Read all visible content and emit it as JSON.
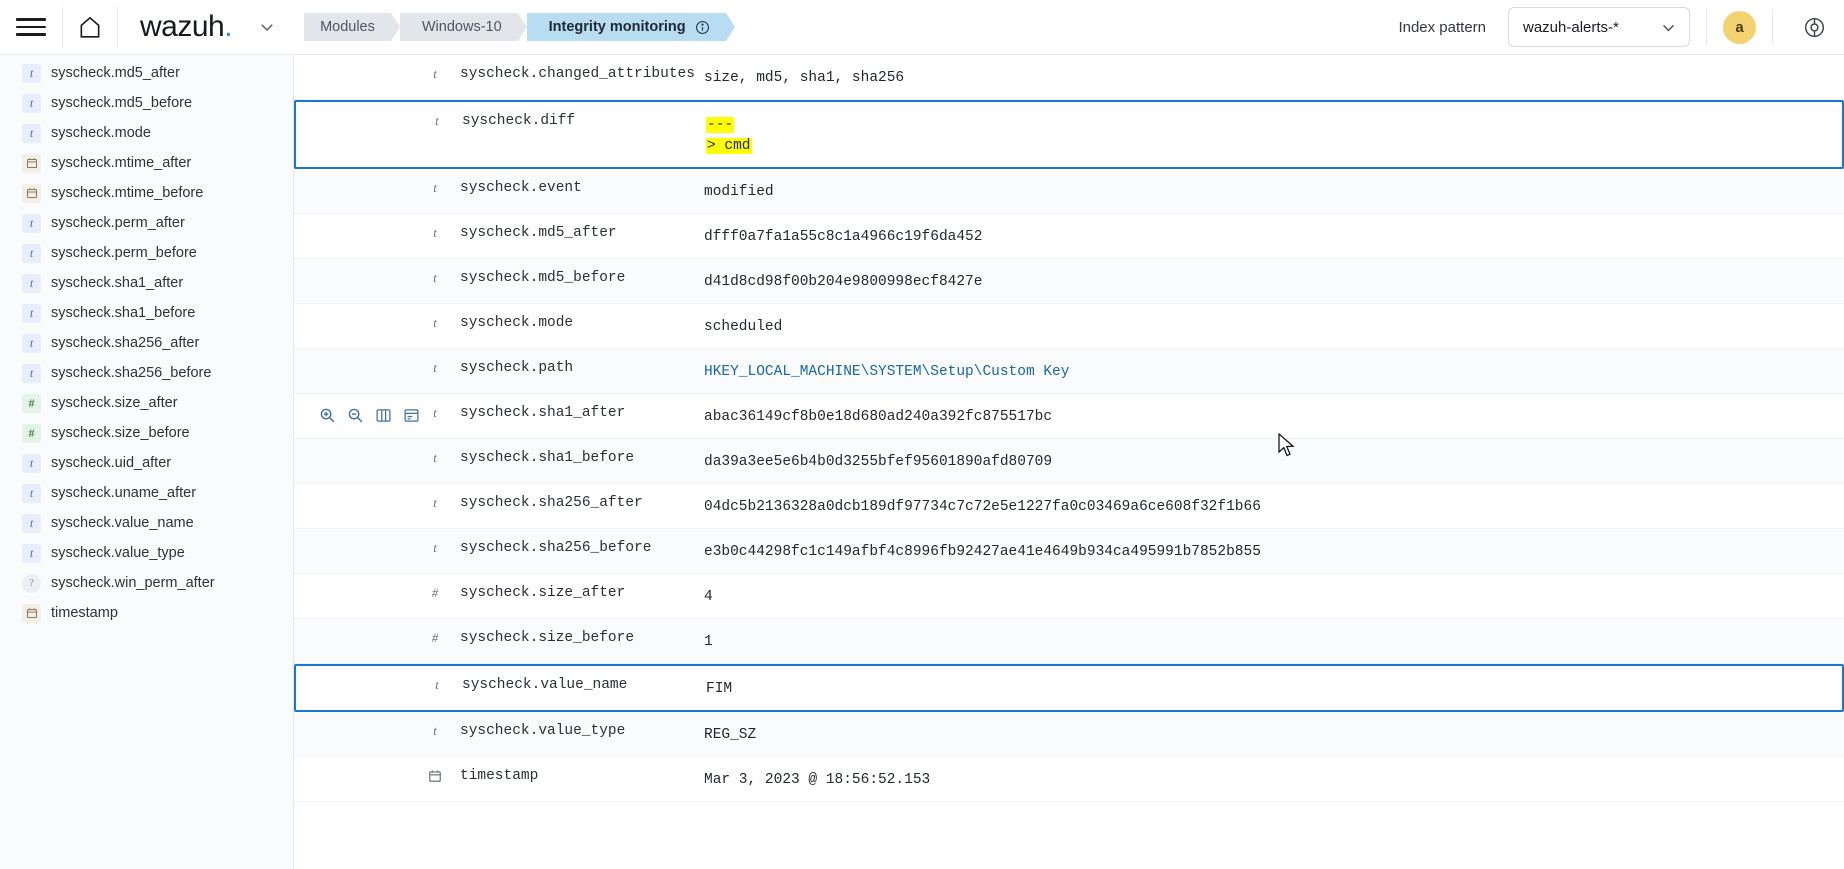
{
  "header": {
    "menu_label": "menu",
    "home_label": "home",
    "logo_text": "wazuh",
    "logo_dot": ".",
    "breadcrumbs": [
      {
        "label": "Modules",
        "active": false
      },
      {
        "label": "Windows-10",
        "active": false
      },
      {
        "label": "Integrity monitoring",
        "active": true,
        "has_info": true
      }
    ],
    "index_pattern_label": "Index pattern",
    "index_pattern_value": "wazuh-alerts-*",
    "avatar_initial": "a",
    "accent_color": "#1878d1",
    "active_crumb_color": "#b8dcf2",
    "avatar_color": "#f3d371"
  },
  "sidebar": {
    "fields": [
      {
        "name": "syscheck.md5_after",
        "type": "t"
      },
      {
        "name": "syscheck.md5_before",
        "type": "t"
      },
      {
        "name": "syscheck.mode",
        "type": "t"
      },
      {
        "name": "syscheck.mtime_after",
        "type": "date"
      },
      {
        "name": "syscheck.mtime_before",
        "type": "date"
      },
      {
        "name": "syscheck.perm_after",
        "type": "t"
      },
      {
        "name": "syscheck.perm_before",
        "type": "t"
      },
      {
        "name": "syscheck.sha1_after",
        "type": "t"
      },
      {
        "name": "syscheck.sha1_before",
        "type": "t"
      },
      {
        "name": "syscheck.sha256_after",
        "type": "t"
      },
      {
        "name": "syscheck.sha256_before",
        "type": "t"
      },
      {
        "name": "syscheck.size_after",
        "type": "#"
      },
      {
        "name": "syscheck.size_before",
        "type": "#"
      },
      {
        "name": "syscheck.uid_after",
        "type": "t"
      },
      {
        "name": "syscheck.uname_after",
        "type": "t"
      },
      {
        "name": "syscheck.value_name",
        "type": "t"
      },
      {
        "name": "syscheck.value_type",
        "type": "t"
      },
      {
        "name": "syscheck.win_perm_after",
        "type": "unknown"
      },
      {
        "name": "timestamp",
        "type": "date"
      }
    ]
  },
  "row_actions": {
    "zoom_in": "magnify-plus-icon",
    "zoom_out": "magnify-minus-icon",
    "toggle_column": "table-column-icon",
    "filter_exists": "document-filter-icon"
  },
  "document": {
    "rows": [
      {
        "type": "t",
        "field": "syscheck.changed_attributes",
        "value": "size, md5, sha1, sha256",
        "style": "plain",
        "alt": false
      },
      {
        "type": "t",
        "field": "syscheck.diff",
        "value": "",
        "diff_lines": [
          "---",
          "> cmd"
        ],
        "style": "boxed",
        "alt": false
      },
      {
        "type": "t",
        "field": "syscheck.event",
        "value": "modified",
        "style": "plain",
        "alt": true
      },
      {
        "type": "t",
        "field": "syscheck.md5_after",
        "value": "dfff0a7fa1a55c8c1a4966c19f6da452",
        "style": "plain",
        "alt": false
      },
      {
        "type": "t",
        "field": "syscheck.md5_before",
        "value": "d41d8cd98f00b204e9800998ecf8427e",
        "style": "plain",
        "alt": true
      },
      {
        "type": "t",
        "field": "syscheck.mode",
        "value": "scheduled",
        "style": "plain",
        "alt": false
      },
      {
        "type": "t",
        "field": "syscheck.path",
        "value": "HKEY_LOCAL_MACHINE\\SYSTEM\\Setup\\Custom Key",
        "style": "link",
        "alt": true
      },
      {
        "type": "t",
        "field": "syscheck.sha1_after",
        "value": "abac36149cf8b0e18d680ad240a392fc875517bc",
        "style": "plain",
        "alt": false,
        "hovered": true
      },
      {
        "type": "t",
        "field": "syscheck.sha1_before",
        "value": "da39a3ee5e6b4b0d3255bfef95601890afd80709",
        "style": "plain",
        "alt": true
      },
      {
        "type": "t",
        "field": "syscheck.sha256_after",
        "value": "04dc5b2136328a0dcb189df97734c7c72e5e1227fa0c03469a6ce608f32f1b66",
        "style": "plain",
        "alt": false
      },
      {
        "type": "t",
        "field": "syscheck.sha256_before",
        "value": "e3b0c44298fc1c149afbf4c8996fb92427ae41e4649b934ca495991b7852b855",
        "style": "plain",
        "alt": true
      },
      {
        "type": "#",
        "field": "syscheck.size_after",
        "value": "4",
        "style": "plain",
        "alt": false
      },
      {
        "type": "#",
        "field": "syscheck.size_before",
        "value": "1",
        "style": "plain",
        "alt": true
      },
      {
        "type": "t",
        "field": "syscheck.value_name",
        "value": "FIM",
        "style": "boxed",
        "alt": false
      },
      {
        "type": "t",
        "field": "syscheck.value_type",
        "value": "REG_SZ",
        "style": "plain",
        "alt": true
      },
      {
        "type": "date",
        "field": "timestamp",
        "value": "Mar 3, 2023 @ 18:56:52.153",
        "style": "plain",
        "alt": false
      }
    ]
  }
}
